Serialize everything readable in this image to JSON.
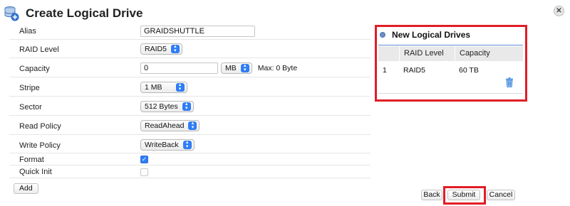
{
  "dialog": {
    "title": "Create Logical Drive"
  },
  "form": {
    "alias_label": "Alias",
    "alias_value": "GRAIDSHUTTLE",
    "raid_level_label": "RAID Level",
    "raid_level_value": "RAID5",
    "capacity_label": "Capacity",
    "capacity_value": "0",
    "capacity_unit": "MB",
    "capacity_max": "Max: 0 Byte",
    "stripe_label": "Stripe",
    "stripe_value": "1 MB",
    "sector_label": "Sector",
    "sector_value": "512 Bytes",
    "read_policy_label": "Read Policy",
    "read_policy_value": "ReadAhead",
    "write_policy_label": "Write Policy",
    "write_policy_value": "WriteBack",
    "format_label": "Format",
    "format_checked": true,
    "quick_init_label": "Quick Init",
    "quick_init_checked": false,
    "add_label": "Add"
  },
  "panel": {
    "title": "New Logical Drives",
    "columns": [
      "RAID Level",
      "Capacity"
    ],
    "rows": [
      {
        "index": "1",
        "raid_level": "RAID5",
        "capacity": "60 TB"
      }
    ]
  },
  "buttons": {
    "back": "Back",
    "submit": "Submit",
    "cancel": "Cancel"
  },
  "colors": {
    "highlight_border": "#e11d26",
    "accent": "#2f7cf6"
  }
}
